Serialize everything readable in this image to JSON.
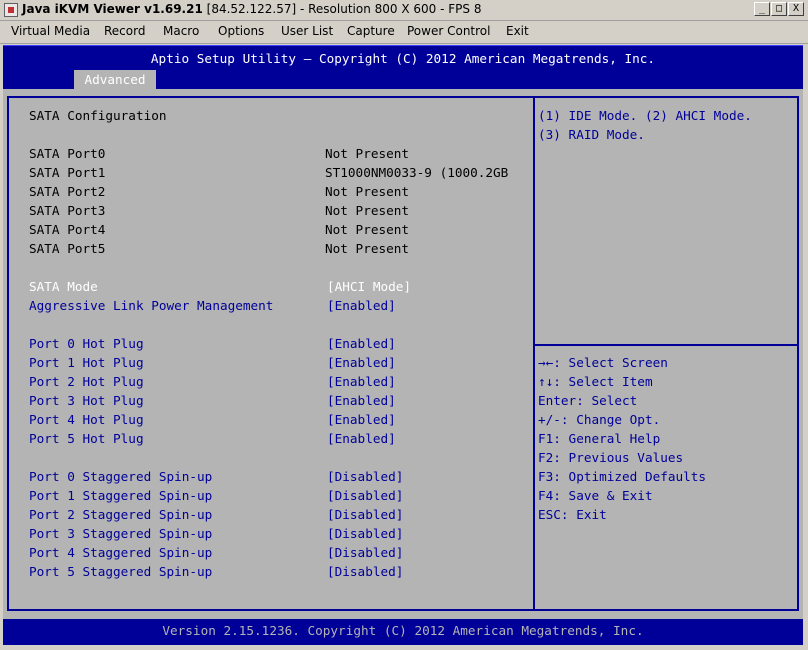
{
  "window": {
    "title_app": "Java iKVM Viewer v1.69.21",
    "title_rest": " [84.52.122.57]  - Resolution 800 X 600 - FPS 8",
    "min_icon": "minimize-icon",
    "max_icon": "maximize-icon",
    "close_icon": "close-icon",
    "min_glyph": "_",
    "max_glyph": "□",
    "close_glyph": "X"
  },
  "menu": [
    "Virtual Media",
    "Record",
    "Macro",
    "Options",
    "User List",
    "Capture",
    "Power Control",
    "Exit"
  ],
  "bios": {
    "title": "Aptio Setup Utility – Copyright (C) 2012 American Megatrends, Inc.",
    "active_tab": "Advanced",
    "section_title": "SATA Configuration",
    "ports": [
      {
        "label": "SATA Port0",
        "value": "Not Present"
      },
      {
        "label": "SATA Port1",
        "value": "ST1000NM0033-9 (1000.2GB"
      },
      {
        "label": "SATA Port2",
        "value": "Not Present"
      },
      {
        "label": "SATA Port3",
        "value": "Not Present"
      },
      {
        "label": "SATA Port4",
        "value": "Not Present"
      },
      {
        "label": "SATA Port5",
        "value": "Not Present"
      }
    ],
    "sata_mode": {
      "label": "SATA Mode",
      "value": "[AHCI Mode]"
    },
    "alpm": {
      "label": "Aggressive Link Power Management",
      "value": "[Enabled]"
    },
    "hot_plug": [
      {
        "label": "Port 0 Hot Plug",
        "value": "[Enabled]"
      },
      {
        "label": "Port 1 Hot Plug",
        "value": "[Enabled]"
      },
      {
        "label": "Port 2 Hot Plug",
        "value": "[Enabled]"
      },
      {
        "label": "Port 3 Hot Plug",
        "value": "[Enabled]"
      },
      {
        "label": "Port 4 Hot Plug",
        "value": "[Enabled]"
      },
      {
        "label": "Port 5 Hot Plug",
        "value": "[Enabled]"
      }
    ],
    "spin_up": [
      {
        "label": "Port 0 Staggered Spin-up",
        "value": "[Disabled]"
      },
      {
        "label": "Port 1 Staggered Spin-up",
        "value": "[Disabled]"
      },
      {
        "label": "Port 2 Staggered Spin-up",
        "value": "[Disabled]"
      },
      {
        "label": "Port 3 Staggered Spin-up",
        "value": "[Disabled]"
      },
      {
        "label": "Port 4 Staggered Spin-up",
        "value": "[Disabled]"
      },
      {
        "label": "Port 5 Staggered Spin-up",
        "value": "[Disabled]"
      }
    ],
    "help": [
      "(1) IDE Mode. (2) AHCI Mode.",
      "(3) RAID Mode."
    ],
    "keys": [
      "→←: Select Screen",
      "↑↓: Select Item",
      "Enter: Select",
      "+/-: Change Opt.",
      "F1: General Help",
      "F2: Previous Values",
      "F3: Optimized Defaults",
      "F4: Save & Exit",
      "ESC: Exit"
    ],
    "footer": "Version 2.15.1236. Copyright (C) 2012 American Megatrends, Inc."
  }
}
